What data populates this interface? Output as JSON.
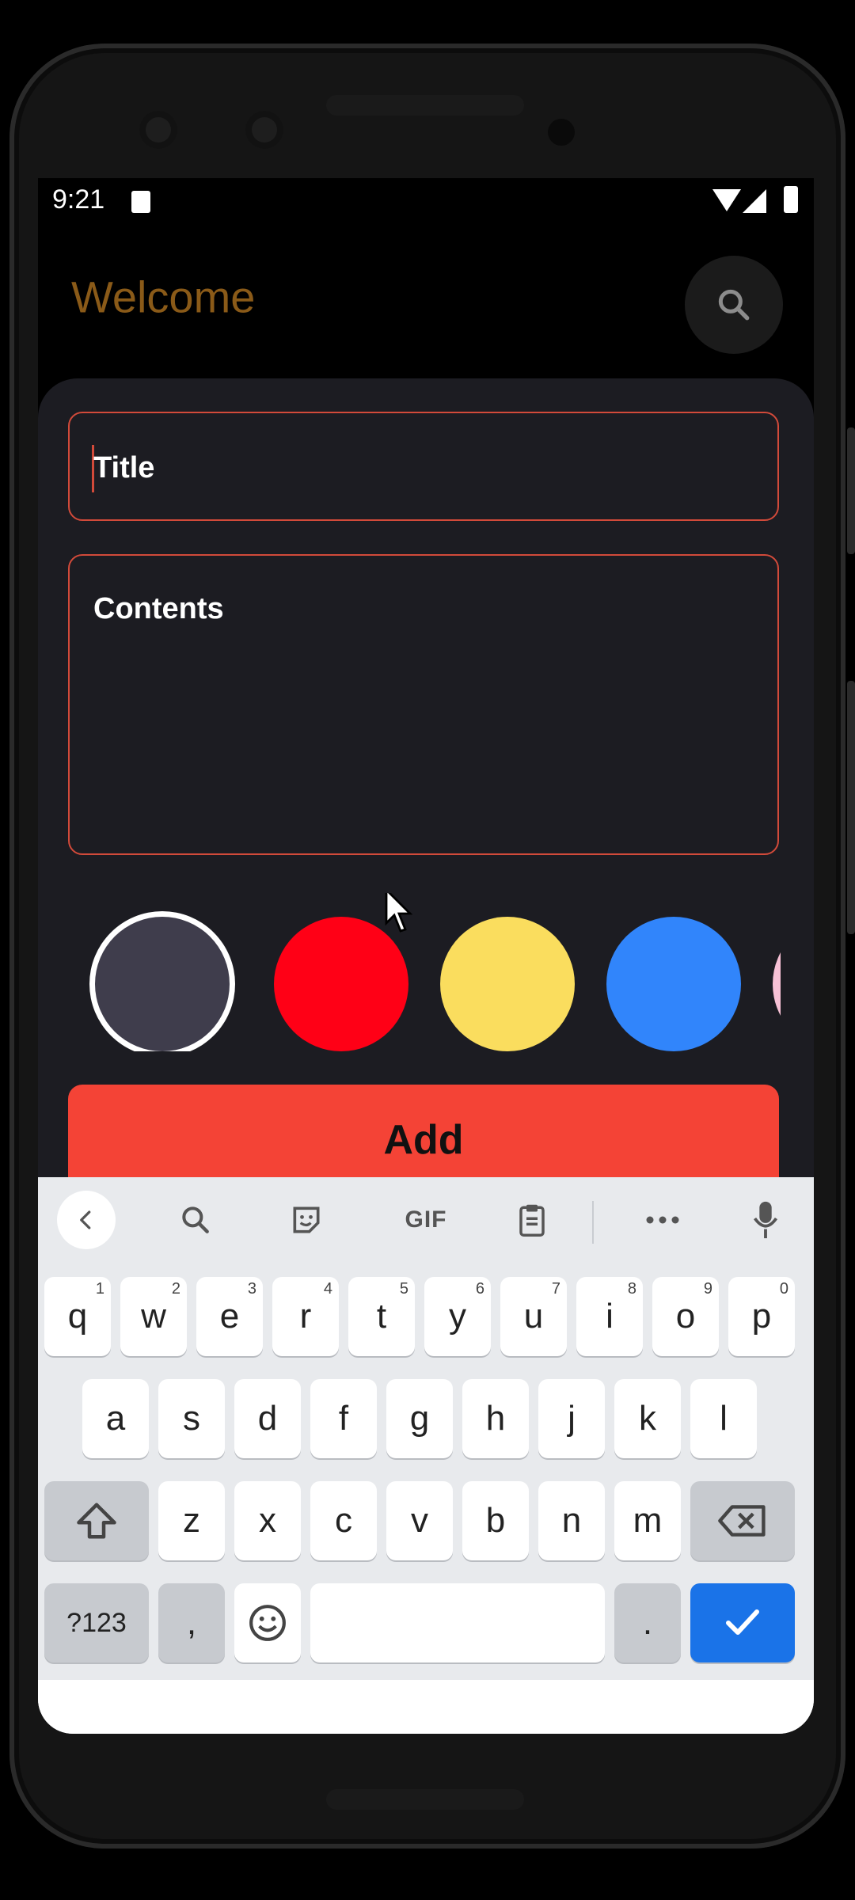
{
  "status": {
    "time": "9:21"
  },
  "app": {
    "title": "Welcome"
  },
  "form": {
    "title_placeholder": "Title",
    "contents_placeholder": "Contents",
    "add_label": "Add"
  },
  "colors": {
    "accent": "#f44336",
    "title_color": "#8a5a18",
    "swatches": [
      "#3f3d4c",
      "#ff0016",
      "#fadd5e",
      "#3185fb",
      "#f7c1d6"
    ],
    "selected_index": 0
  },
  "keyboard": {
    "toolbar": [
      "back",
      "search",
      "sticker",
      "GIF",
      "clipboard",
      "more",
      "mic"
    ],
    "gif_label": "GIF",
    "row1": [
      {
        "k": "q",
        "h": "1"
      },
      {
        "k": "w",
        "h": "2"
      },
      {
        "k": "e",
        "h": "3"
      },
      {
        "k": "r",
        "h": "4"
      },
      {
        "k": "t",
        "h": "5"
      },
      {
        "k": "y",
        "h": "6"
      },
      {
        "k": "u",
        "h": "7"
      },
      {
        "k": "i",
        "h": "8"
      },
      {
        "k": "o",
        "h": "9"
      },
      {
        "k": "p",
        "h": "0"
      }
    ],
    "row2": [
      "a",
      "s",
      "d",
      "f",
      "g",
      "h",
      "j",
      "k",
      "l"
    ],
    "row3": [
      "z",
      "x",
      "c",
      "v",
      "b",
      "n",
      "m"
    ],
    "symbols_label": "?123",
    "comma": ",",
    "period": "."
  }
}
